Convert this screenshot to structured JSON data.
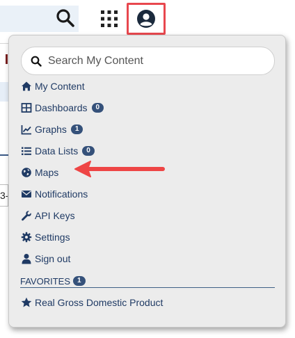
{
  "topbar": {
    "search_icon": "search-icon",
    "apps_icon": "grid-icon",
    "account_icon": "user-circle-icon"
  },
  "background_fragment_text": "3-",
  "menu": {
    "search": {
      "placeholder": "Search My Content"
    },
    "items": [
      {
        "label": "My Content",
        "icon": "home-icon"
      },
      {
        "label": "Dashboards",
        "icon": "dashboard-icon",
        "badge": "0"
      },
      {
        "label": "Graphs",
        "icon": "line-chart-icon",
        "badge": "1"
      },
      {
        "label": "Data Lists",
        "icon": "list-icon",
        "badge": "0"
      },
      {
        "label": "Maps",
        "icon": "globe-icon"
      },
      {
        "label": "Notifications",
        "icon": "envelope-icon"
      },
      {
        "label": "API Keys",
        "icon": "wrench-icon"
      },
      {
        "label": "Settings",
        "icon": "gear-icon"
      },
      {
        "label": "Sign out",
        "icon": "person-icon"
      }
    ],
    "favorites": {
      "label": "FAVORITES",
      "badge": "1",
      "items": [
        {
          "label": "Real Gross Domestic Product",
          "icon": "star-icon"
        }
      ]
    }
  },
  "colors": {
    "accent": "#1f3a64",
    "badge": "#35517a",
    "highlight": "#e8474e",
    "menu_bg": "#ececec"
  }
}
